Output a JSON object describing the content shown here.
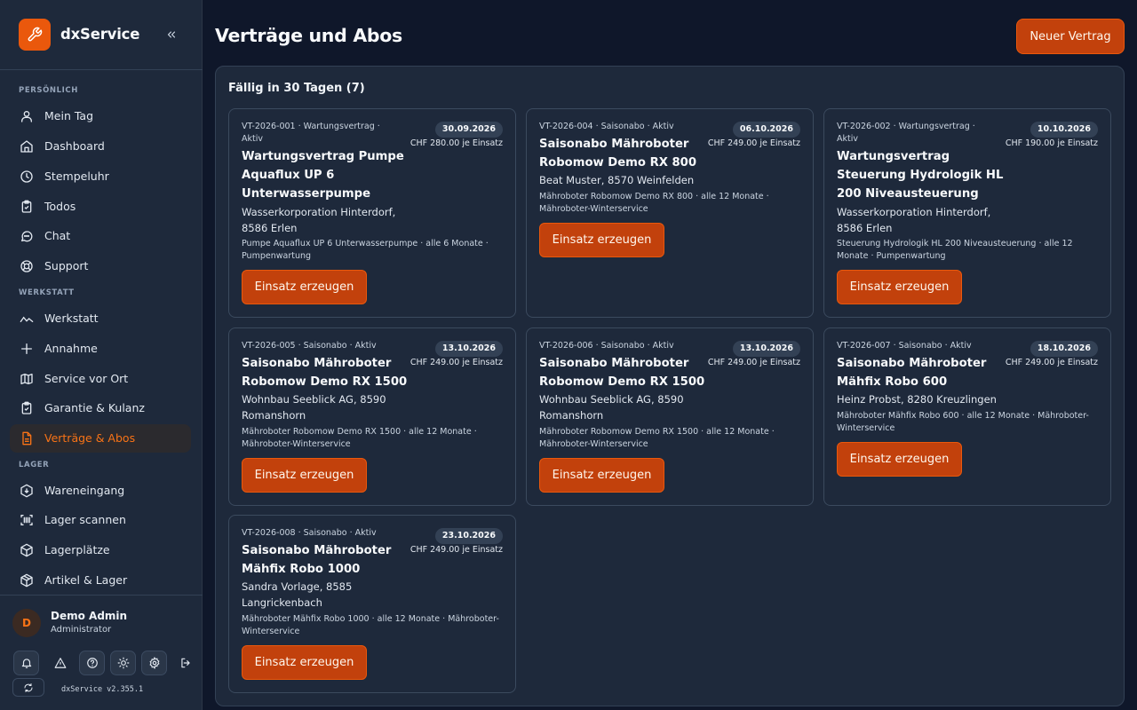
{
  "app": {
    "name": "dxService",
    "version": "dxService v2.355.1"
  },
  "sidebar": {
    "sections": {
      "personal": "PERSÖNLICH",
      "workshop": "WERKSTATT",
      "storage": "LAGER"
    },
    "items": [
      {
        "label": "Mein Tag",
        "icon": "user-icon"
      },
      {
        "label": "Dashboard",
        "icon": "home-icon"
      },
      {
        "label": "Stempeluhr",
        "icon": "clock-icon"
      },
      {
        "label": "Todos",
        "icon": "clipboard-icon"
      },
      {
        "label": "Chat",
        "icon": "chat-icon"
      },
      {
        "label": "Support",
        "icon": "lifebuoy-icon"
      },
      {
        "label": "Werkstatt",
        "icon": "wave-icon"
      },
      {
        "label": "Annahme",
        "icon": "plus-icon"
      },
      {
        "label": "Service vor Ort",
        "icon": "map-icon"
      },
      {
        "label": "Garantie & Kulanz",
        "icon": "clipboard-check-icon"
      },
      {
        "label": "Verträge & Abos",
        "icon": "document-icon",
        "active": true
      },
      {
        "label": "Wareneingang",
        "icon": "download-icon"
      },
      {
        "label": "Lager scannen",
        "icon": "barcode-icon"
      },
      {
        "label": "Lagerplätze",
        "icon": "box-icon"
      },
      {
        "label": "Artikel & Lager",
        "icon": "package-icon"
      }
    ]
  },
  "user": {
    "initial": "D",
    "name": "Demo Admin",
    "role": "Administrator"
  },
  "page": {
    "title": "Verträge und Abos",
    "new_button": "Neuer Vertrag"
  },
  "panel": {
    "title": "Fällig in 30 Tagen (7)"
  },
  "contracts": [
    {
      "meta": "VT-2026-001 · Wartungsvertrag · Aktiv",
      "date": "30.09.2026",
      "price": "CHF 280.00 je Einsatz",
      "title": "Wartungsvertrag Pumpe Aquaflux UP 6 Unterwasserpumpe",
      "customer": "Wasserkorporation Hinterdorf, 8586 Erlen",
      "desc": "Pumpe Aquaflux UP 6 Unterwasserpumpe · alle 6 Monate · Pumpenwartung",
      "action": "Einsatz erzeugen"
    },
    {
      "meta": "VT-2026-004 · Saisonabo · Aktiv",
      "date": "06.10.2026",
      "price": "CHF 249.00 je Einsatz",
      "title": "Saisonabo Mähroboter Robomow Demo RX 800",
      "customer": "Beat Muster, 8570 Weinfelden",
      "desc": "Mähroboter Robomow Demo RX 800 · alle 12 Monate · Mähroboter-Winterservice",
      "action": "Einsatz erzeugen"
    },
    {
      "meta": "VT-2026-002 · Wartungsvertrag · Aktiv",
      "date": "10.10.2026",
      "price": "CHF 190.00 je Einsatz",
      "title": "Wartungsvertrag Steuerung Hydrologik HL 200 Niveausteuerung",
      "customer": "Wasserkorporation Hinterdorf, 8586 Erlen",
      "desc": "Steuerung Hydrologik HL 200 Niveausteuerung · alle 12 Monate · Pumpenwartung",
      "action": "Einsatz erzeugen"
    },
    {
      "meta": "VT-2026-005 · Saisonabo · Aktiv",
      "date": "13.10.2026",
      "price": "CHF 249.00 je Einsatz",
      "title": "Saisonabo Mähroboter Robomow Demo RX 1500",
      "customer": "Wohnbau Seeblick AG, 8590 Romanshorn",
      "desc": "Mähroboter Robomow Demo RX 1500 · alle 12 Monate · Mähroboter-Winterservice",
      "action": "Einsatz erzeugen"
    },
    {
      "meta": "VT-2026-006 · Saisonabo · Aktiv",
      "date": "13.10.2026",
      "price": "CHF 249.00 je Einsatz",
      "title": "Saisonabo Mähroboter Robomow Demo RX 1500",
      "customer": "Wohnbau Seeblick AG, 8590 Romanshorn",
      "desc": "Mähroboter Robomow Demo RX 1500 · alle 12 Monate · Mähroboter-Winterservice",
      "action": "Einsatz erzeugen"
    },
    {
      "meta": "VT-2026-007 · Saisonabo · Aktiv",
      "date": "18.10.2026",
      "price": "CHF 249.00 je Einsatz",
      "title": "Saisonabo Mähroboter Mähfix Robo 600",
      "customer": "Heinz Probst, 8280 Kreuzlingen",
      "desc": "Mähroboter Mähfix Robo 600 · alle 12 Monate · Mähroboter-Winterservice",
      "action": "Einsatz erzeugen"
    },
    {
      "meta": "VT-2026-008 · Saisonabo · Aktiv",
      "date": "23.10.2026",
      "price": "CHF 249.00 je Einsatz",
      "title": "Saisonabo Mähroboter Mähfix Robo 1000",
      "customer": "Sandra Vorlage, 8585 Langrickenbach",
      "desc": "Mähroboter Mähfix Robo 1000 · alle 12 Monate · Mähroboter-Winterservice",
      "action": "Einsatz erzeugen"
    }
  ],
  "colors": {
    "accent": "#ea580c",
    "button": "#c2410c",
    "background": "#0f172a",
    "surface": "#1e293b"
  }
}
